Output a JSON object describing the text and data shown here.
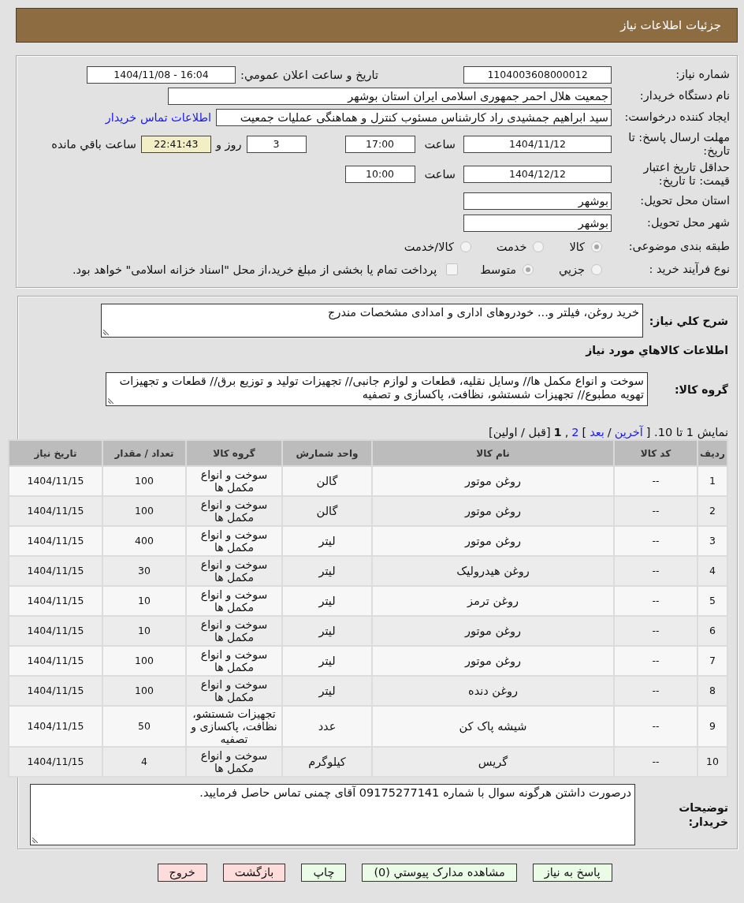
{
  "header": {
    "title": "جزئیات اطلاعات نیاز"
  },
  "details": {
    "need_number": {
      "label": "شماره نیاز:",
      "value": "1104003608000012"
    },
    "announce": {
      "label": "تاريخ و ساعت اعلان عمومي:",
      "value": "1404/11/08 - 16:04"
    },
    "buyer_org": {
      "label": "نام دستگاه خریدار:",
      "value": "جمعیت هلال احمر جمهوری اسلامی ایران استان بوشهر"
    },
    "requester": {
      "label": "ایجاد کننده درخواست:",
      "value": "سید ابراهیم جمشیدی راد کارشناس مسئوب کنترل و هماهنگی عملیات جمعیت",
      "contact_link": "اطلاعات تماس خریدار"
    },
    "reply_deadline": {
      "label": "مهلت ارسال پاسخ: تا تاریخ:",
      "date": "1404/11/12",
      "time_label": "ساعت",
      "time": "17:00",
      "days": "3",
      "days_label": "روز و",
      "remaining": "22:41:43",
      "remaining_label": "ساعت باقي مانده"
    },
    "price_validity": {
      "label": "حداقل تاریخ اعتبار قیمت: تا تاریخ:",
      "date": "1404/12/12",
      "time_label": "ساعت",
      "time": "10:00"
    },
    "province": {
      "label": "استان محل تحویل:",
      "value": "بوشهر"
    },
    "city": {
      "label": "شهر محل تحویل:",
      "value": "بوشهر"
    },
    "category": {
      "label": "طبقه بندی موضوعی:",
      "options": [
        {
          "label": "کالا",
          "selected": true,
          "disabled": true
        },
        {
          "label": "خدمت",
          "selected": false,
          "disabled": true
        },
        {
          "label": "کالا/خدمت",
          "selected": false,
          "disabled": true
        }
      ]
    },
    "purchase_type": {
      "label": "نوع فرآیند خرید :",
      "options": [
        {
          "label": "جزيي",
          "selected": false,
          "disabled": true
        },
        {
          "label": "متوسط",
          "selected": true,
          "disabled": true
        }
      ],
      "treasury": {
        "label": "پرداخت تمام یا بخشی از مبلغ خرید،از محل \"اسناد خزانه اسلامی\" خواهد بود.",
        "checked": false,
        "disabled": true
      }
    }
  },
  "needs": {
    "description": {
      "label": "شرح کلي نیاز:",
      "value": "خرید روغن، فیلتر و... خودروهای اداری و امدادی مشخصات مندرج"
    },
    "goods_heading": "اطلاعات کالاهاي مورد نیاز",
    "goods_group": {
      "label": "گروه کالا:",
      "value": "سوخت و انواع مکمل ها// وسایل نقلیه، قطعات و لوازم جانبی// تجهیزات تولید و توزیع برق// قطعات و تجهیزات تهویه مطبوع// تجهیزات شستشو، نظافت، پاکسازی و تصفیه"
    },
    "pagination": [
      {
        "kind": "text",
        "text": "نمایش 1 تا 10. ["
      },
      {
        "kind": "link",
        "text": "آخرین"
      },
      {
        "kind": "text",
        "text": "/"
      },
      {
        "kind": "link",
        "text": "بعد"
      },
      {
        "kind": "text",
        "text": "]"
      },
      {
        "kind": "link",
        "text": "2"
      },
      {
        "kind": "text",
        "text": ","
      },
      {
        "kind": "current",
        "text": "1"
      },
      {
        "kind": "text",
        "text": "[قبل / اولین]"
      }
    ],
    "table": {
      "columns": [
        "ردیف",
        "کد کالا",
        "نام کالا",
        "واحد شمارش",
        "گروه کالا",
        "تعداد / مقدار",
        "تاریخ نیاز"
      ],
      "rows": [
        [
          "1",
          "--",
          "روغن موتور",
          "گالن",
          "سوخت و انواع مکمل ها",
          "100",
          "1404/11/15"
        ],
        [
          "2",
          "--",
          "روغن موتور",
          "گالن",
          "سوخت و انواع مکمل ها",
          "100",
          "1404/11/15"
        ],
        [
          "3",
          "--",
          "روغن موتور",
          "لیتر",
          "سوخت و انواع مکمل ها",
          "400",
          "1404/11/15"
        ],
        [
          "4",
          "--",
          "روغن هیدرولیک",
          "لیتر",
          "سوخت و انواع مکمل ها",
          "30",
          "1404/11/15"
        ],
        [
          "5",
          "--",
          "روغن ترمز",
          "لیتر",
          "سوخت و انواع مکمل ها",
          "10",
          "1404/11/15"
        ],
        [
          "6",
          "--",
          "روغن موتور",
          "لیتر",
          "سوخت و انواع مکمل ها",
          "10",
          "1404/11/15"
        ],
        [
          "7",
          "--",
          "روغن موتور",
          "لیتر",
          "سوخت و انواع مکمل ها",
          "100",
          "1404/11/15"
        ],
        [
          "8",
          "--",
          "روغن دنده",
          "لیتر",
          "سوخت و انواع مکمل ها",
          "100",
          "1404/11/15"
        ],
        [
          "9",
          "--",
          "شیشه پاک کن",
          "عدد",
          "تجهیزات شستشو، نظافت، پاکسازی و تصفیه",
          "50",
          "1404/11/15"
        ],
        [
          "10",
          "--",
          "گریس",
          "کیلوگرم",
          "سوخت و انواع مکمل ها",
          "4",
          "1404/11/15"
        ]
      ]
    },
    "buyer_notes": {
      "label": "توضیحات خریدار:",
      "value": "درصورت داشتن هرگونه سوال با شماره 09175277141 آقای چمنی تماس حاصل فرمایید."
    }
  },
  "buttons": [
    {
      "label": "پاسخ به نیاز",
      "kind": "confirm"
    },
    {
      "label": "مشاهده مدارک پیوستي (0)",
      "kind": "confirm"
    },
    {
      "label": "چاپ",
      "kind": "confirm"
    },
    {
      "label": "بازگشت",
      "kind": "cancel"
    },
    {
      "label": "خروج",
      "kind": "cancel"
    }
  ]
}
